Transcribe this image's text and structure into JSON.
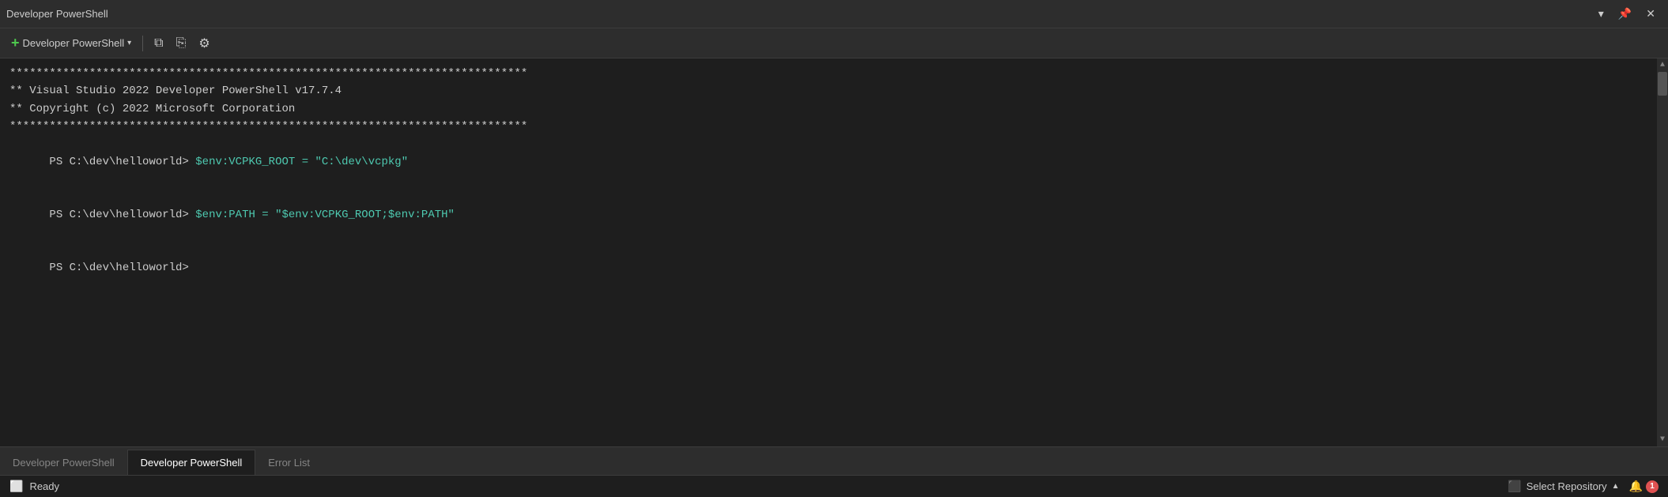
{
  "titlebar": {
    "title": "Developer PowerShell",
    "pin_label": "📌",
    "close_label": "✕",
    "dropdown_label": "▾"
  },
  "toolbar": {
    "new_label": "Developer PowerShell",
    "split_icon": "⧉",
    "copy_icon": "⎘",
    "gear_icon": "⚙"
  },
  "terminal": {
    "line1": "******************************************************************************",
    "line2": "** Visual Studio 2022 Developer PowerShell v17.7.4",
    "line3": "** Copyright (c) 2022 Microsoft Corporation",
    "line4": "******************************************************************************",
    "line5_prompt": "PS C:\\dev\\helloworld> ",
    "line5_cmd": "$env:VCPKG_ROOT = \"C:\\dev\\vcpkg\"",
    "line6_prompt": "PS C:\\dev\\helloworld> ",
    "line6_cmd": "$env:PATH = \"$env:VCPKG_ROOT;$env:PATH\"",
    "line7_prompt": "PS C:\\dev\\helloworld> "
  },
  "tabs": [
    {
      "label": "Developer PowerShell",
      "active": false
    },
    {
      "label": "Developer PowerShell",
      "active": true
    },
    {
      "label": "Error List",
      "active": false
    }
  ],
  "statusbar": {
    "ready_icon": "⬜",
    "ready_label": "Ready",
    "select_repo_icon": "⬛",
    "select_repo_label": "Select Repository",
    "arrow_up": "▲",
    "bell_icon": "🔔",
    "notification_count": "1"
  }
}
